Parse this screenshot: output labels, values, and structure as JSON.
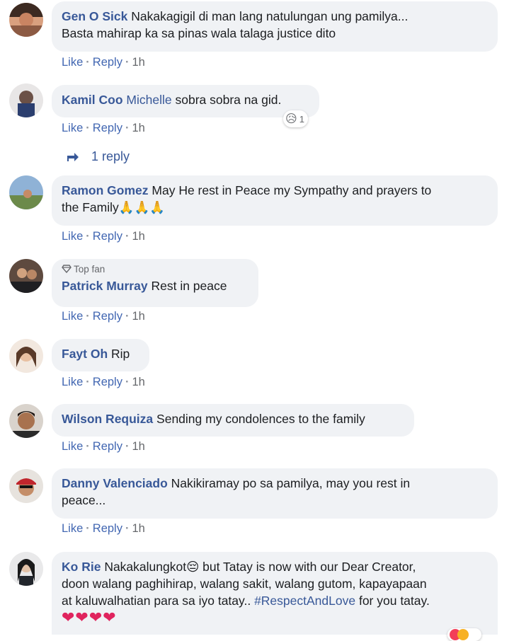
{
  "actions": {
    "like": "Like",
    "reply": "Reply",
    "sep": "·"
  },
  "comments": [
    {
      "author": "Gen O Sick",
      "text": "Nakakagigil di man lang natulungan ung pamilya...",
      "text2": "Basta mahirap ka sa pinas wala talaga justice dito",
      "time": "1h"
    },
    {
      "author": "Kamil Coo",
      "mention": "Michelle",
      "text": "sobra sobra na gid.",
      "time": "1h",
      "reaction_count": "1",
      "reaction": "😥",
      "replies": "1 reply"
    },
    {
      "author": "Ramon Gomez",
      "text": "May He rest in Peace my Sympathy and prayers to",
      "text2": "the Family🙏🙏🙏",
      "time": "1h"
    },
    {
      "badge": "Top fan",
      "author": "Patrick Murray",
      "text": "Rest in peace",
      "time": "1h"
    },
    {
      "author": "Fayt Oh",
      "text": "Rip",
      "time": "1h"
    },
    {
      "author": "Wilson Requiza",
      "text": "Sending my condolences to the family",
      "time": "1h"
    },
    {
      "author": "Danny Valenciado",
      "text": "Nakikiramay po sa pamilya, may you rest in",
      "text2": "peace...",
      "time": "1h"
    },
    {
      "author": "Ko Rie",
      "text": "Nakakalungkot😔 but Tatay is now with our Dear Creator,",
      "text2": "doon walang paghihirap, walang sakit, walang gutom, kapayapaan",
      "text3a": "at kaluwalhatian para sa iyo tatay.. ",
      "hashtag": "#RespectAndLove",
      "text3b": " for you tatay.",
      "hearts": "❤❤❤❤"
    }
  ]
}
